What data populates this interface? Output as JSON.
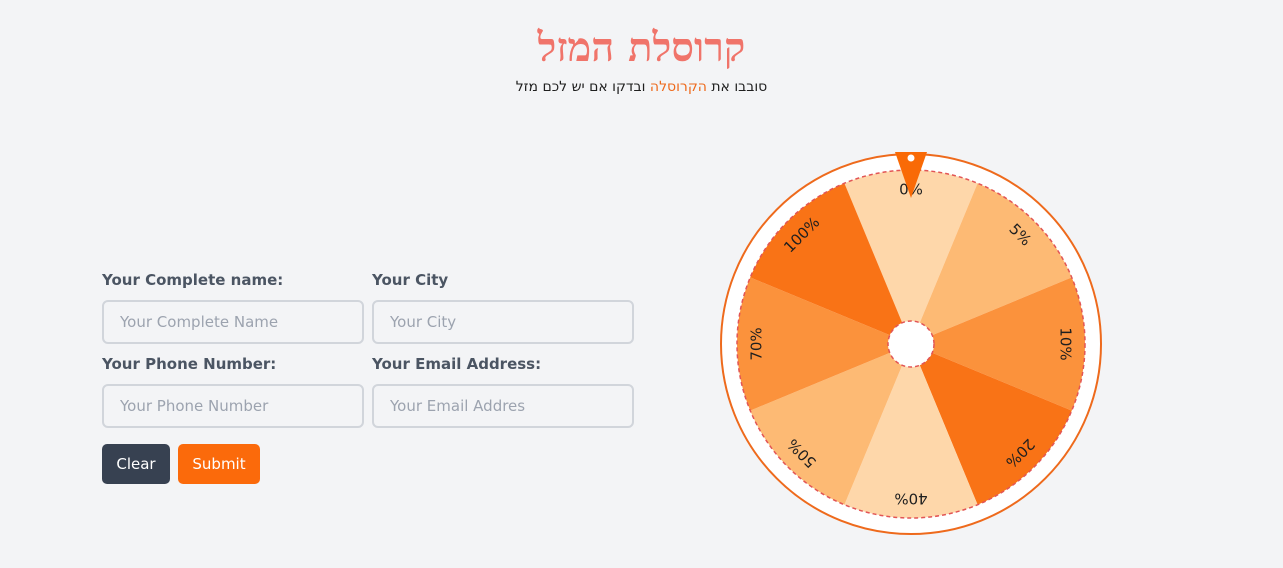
{
  "header": {
    "title": "קרוסלת המזל",
    "subtitle_part1": "סובבו את ",
    "subtitle_accent": "הקרוסלה",
    "subtitle_part2": " ובדקו אם יש לכם מזל"
  },
  "form": {
    "name": {
      "label": "Your Complete name:",
      "placeholder": "Your Complete Name",
      "value": ""
    },
    "city": {
      "label": "Your City",
      "placeholder": "Your City",
      "value": ""
    },
    "phone": {
      "label": "Your Phone Number:",
      "placeholder": "Your Phone Number",
      "value": ""
    },
    "email": {
      "label": "Your Email Address:",
      "placeholder": "Your Email Addres",
      "value": ""
    },
    "clear_label": "Clear",
    "submit_label": "Submit"
  },
  "wheel": {
    "segments": [
      {
        "label": "0%",
        "color": "#fed7aa"
      },
      {
        "label": "5%",
        "color": "#fdba74"
      },
      {
        "label": "10%",
        "color": "#fb923c"
      },
      {
        "label": "20%",
        "color": "#f97316"
      },
      {
        "label": "40%",
        "color": "#fed7aa"
      },
      {
        "label": "50%",
        "color": "#fdba74"
      },
      {
        "label": "70%",
        "color": "#fb923c"
      },
      {
        "label": "100%",
        "color": "#f97316"
      }
    ],
    "ring_color": "#ee6a1c",
    "dash_color": "#e25555",
    "pointer_color": "#f96a06"
  }
}
